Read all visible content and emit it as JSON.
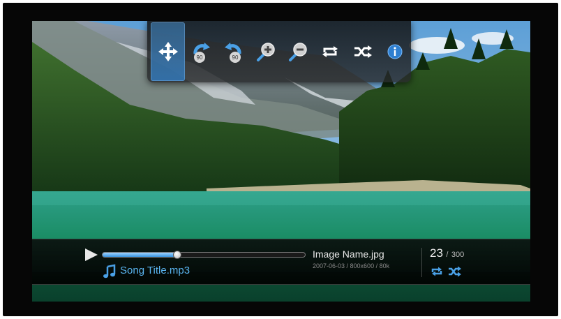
{
  "toolbar": {
    "buttons": [
      {
        "name": "pan",
        "icon": "move-icon",
        "active": true
      },
      {
        "name": "rotate-right-90",
        "icon": "rotate-clockwise-icon",
        "badge": "90"
      },
      {
        "name": "rotate-left-90",
        "icon": "rotate-counterclockwise-icon",
        "badge": "90"
      },
      {
        "name": "zoom-in",
        "icon": "zoom-in-icon"
      },
      {
        "name": "zoom-out",
        "icon": "zoom-out-icon"
      },
      {
        "name": "repeat",
        "icon": "repeat-icon"
      },
      {
        "name": "shuffle",
        "icon": "shuffle-icon"
      },
      {
        "name": "info",
        "icon": "info-icon"
      }
    ],
    "accent": "#3a94e0"
  },
  "player": {
    "progress": 0.37,
    "song_title": "Song Title.mp3",
    "image_name": "Image Name.jpg",
    "image_meta": "2007-06-03 / 800x600 / 80k",
    "current_index": "23",
    "separator": "/",
    "total": "300",
    "accent": "#5ab4f0"
  }
}
